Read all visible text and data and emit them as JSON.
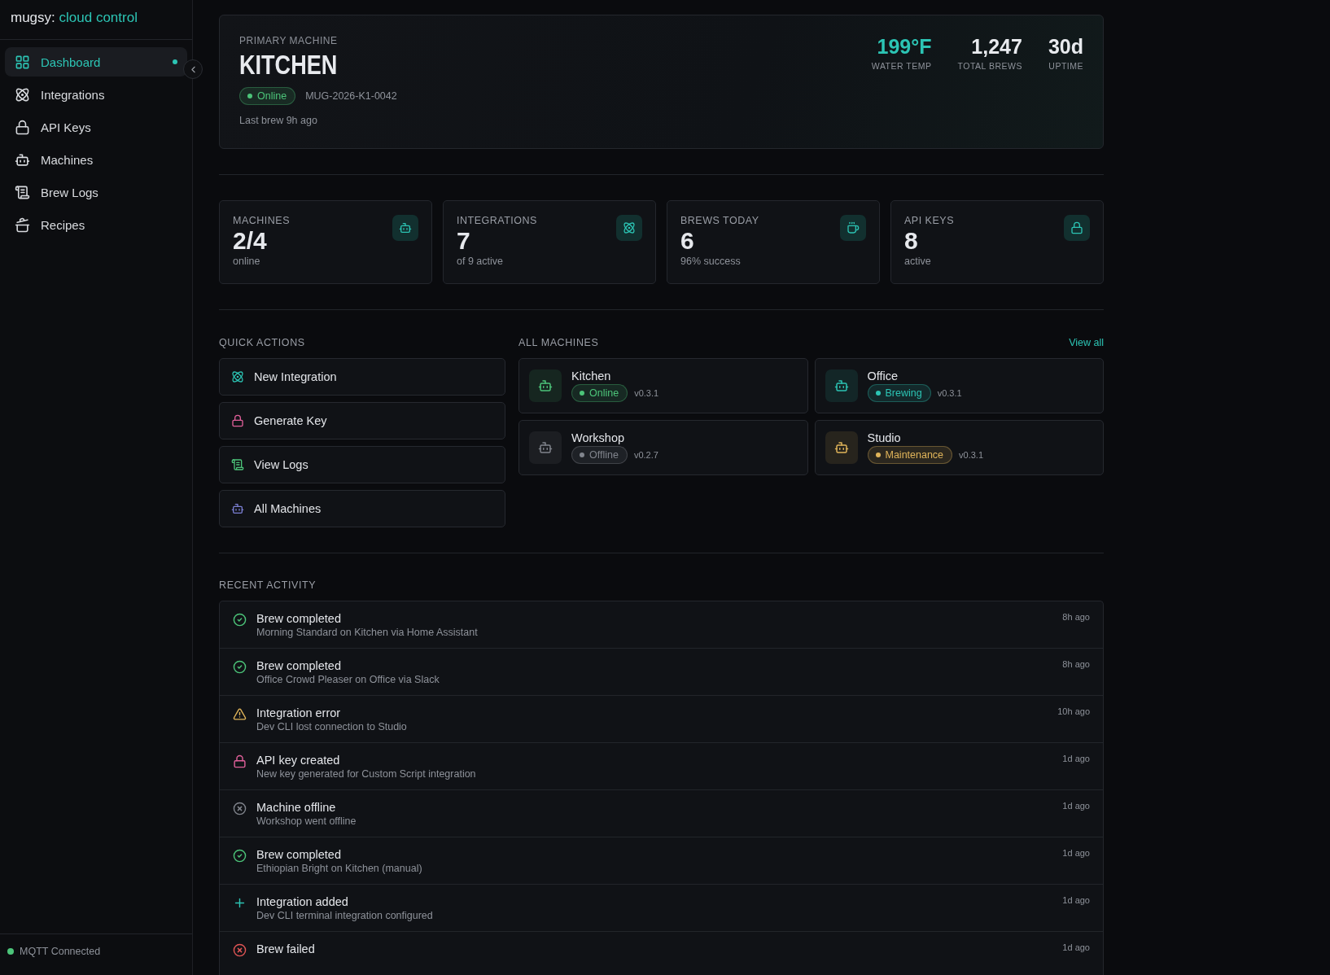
{
  "brand": {
    "name": "mugsy:",
    "product": "cloud control"
  },
  "sidebar": {
    "items": [
      {
        "label": "Dashboard",
        "kind": "dashboard",
        "selected": true
      },
      {
        "label": "Integrations",
        "kind": "integrations",
        "selected": false
      },
      {
        "label": "API Keys",
        "kind": "keys",
        "selected": false
      },
      {
        "label": "Machines",
        "kind": "machines",
        "selected": false
      },
      {
        "label": "Brew Logs",
        "kind": "logs",
        "selected": false
      },
      {
        "label": "Recipes",
        "kind": "recipes",
        "selected": false
      }
    ],
    "status": {
      "label": "MQTT Connected",
      "color": "#4cc479"
    }
  },
  "hero": {
    "eyebrow": "PRIMARY MACHINE",
    "title": "KITCHEN",
    "status": {
      "label": "Online",
      "color": "#4cc479"
    },
    "serial": "MUG-2026-K1-0042",
    "last_brew": "Last brew 9h ago",
    "metrics": [
      {
        "value": "199°F",
        "label": "WATER TEMP",
        "accent": true
      },
      {
        "value": "1,247",
        "label": "TOTAL BREWS",
        "accent": false
      },
      {
        "value": "30d",
        "label": "UPTIME",
        "accent": false
      }
    ]
  },
  "stats": [
    {
      "label": "MACHINES",
      "value": "2/4",
      "sub": "online",
      "kind": "machines"
    },
    {
      "label": "INTEGRATIONS",
      "value": "7",
      "sub": "of 9 active",
      "kind": "integrations"
    },
    {
      "label": "BREWS TODAY",
      "value": "6",
      "sub": "96% success",
      "kind": "brews"
    },
    {
      "label": "API KEYS",
      "value": "8",
      "sub": "active",
      "kind": "keys"
    }
  ],
  "quick_actions": {
    "title": "QUICK ACTIONS",
    "items": [
      {
        "label": "New Integration",
        "kind": "integrations",
        "color": "#2cc4b4"
      },
      {
        "label": "Generate Key",
        "kind": "keys",
        "color": "#e0609a"
      },
      {
        "label": "View Logs",
        "kind": "logs",
        "color": "#4cc479"
      },
      {
        "label": "All Machines",
        "kind": "machines",
        "color": "#7b7fd4"
      }
    ]
  },
  "machines": {
    "title": "ALL MACHINES",
    "link": "View all",
    "items": [
      {
        "name": "Kitchen",
        "status": "Online",
        "color": "#4cc479",
        "version": "v0.3.1"
      },
      {
        "name": "Office",
        "status": "Brewing",
        "color": "#2cc4b4",
        "version": "v0.3.1"
      },
      {
        "name": "Workshop",
        "status": "Offline",
        "color": "#80848c",
        "version": "v0.2.7"
      },
      {
        "name": "Studio",
        "status": "Maintenance",
        "color": "#e0b45a",
        "version": "v0.3.1"
      }
    ]
  },
  "activity": {
    "title": "RECENT ACTIVITY",
    "items": [
      {
        "kind": "success",
        "title": "Brew completed",
        "detail": "Morning Standard on Kitchen via Home Assistant",
        "time": "8h ago"
      },
      {
        "kind": "success",
        "title": "Brew completed",
        "detail": "Office Crowd Pleaser on Office via Slack",
        "time": "8h ago"
      },
      {
        "kind": "warning",
        "title": "Integration error",
        "detail": "Dev CLI lost connection to Studio",
        "time": "10h ago"
      },
      {
        "kind": "key",
        "title": "API key created",
        "detail": "New key generated for Custom Script integration",
        "time": "1d ago"
      },
      {
        "kind": "offline",
        "title": "Machine offline",
        "detail": "Workshop went offline",
        "time": "1d ago"
      },
      {
        "kind": "success",
        "title": "Brew completed",
        "detail": "Ethiopian Bright on Kitchen (manual)",
        "time": "1d ago"
      },
      {
        "kind": "added",
        "title": "Integration added",
        "detail": "Dev CLI terminal integration configured",
        "time": "1d ago"
      },
      {
        "kind": "failed",
        "title": "Brew failed",
        "time": "1d ago"
      }
    ]
  }
}
